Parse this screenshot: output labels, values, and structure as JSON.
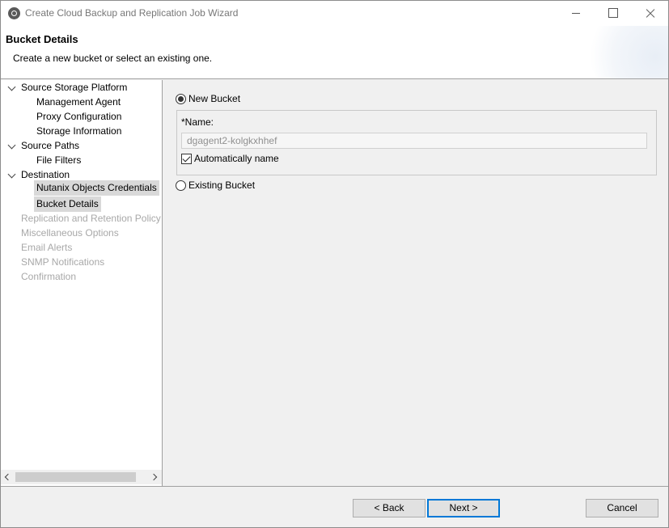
{
  "window": {
    "title": "Create Cloud Backup and Replication Job Wizard"
  },
  "header": {
    "title": "Bucket Details",
    "subtitle": "Create a new bucket or select an existing one."
  },
  "nav": {
    "items": [
      {
        "label": "Source Storage Platform",
        "state": "expanded"
      },
      {
        "label": "Management Agent",
        "state": "child"
      },
      {
        "label": "Proxy Configuration",
        "state": "child"
      },
      {
        "label": "Storage Information",
        "state": "child"
      },
      {
        "label": "Source Paths",
        "state": "expanded"
      },
      {
        "label": "File Filters",
        "state": "child"
      },
      {
        "label": "Destination",
        "state": "expanded"
      },
      {
        "label": "Nutanix Objects Credentials",
        "state": "selected"
      },
      {
        "label": "Bucket Details",
        "state": "selected-current"
      },
      {
        "label": "Replication and Retention Policy",
        "state": "disabled"
      },
      {
        "label": "Miscellaneous Options",
        "state": "disabled"
      },
      {
        "label": "Email Alerts",
        "state": "disabled"
      },
      {
        "label": "SNMP Notifications",
        "state": "disabled"
      },
      {
        "label": "Confirmation",
        "state": "disabled"
      }
    ]
  },
  "form": {
    "new_bucket_label": "New Bucket",
    "new_bucket_selected": true,
    "name_label": "*Name:",
    "name_value": "dgagent2-kolgkxhhef",
    "auto_name_label": "Automatically name",
    "auto_name_checked": true,
    "existing_bucket_label": "Existing Bucket",
    "existing_bucket_selected": false
  },
  "footer": {
    "back_label": "< Back",
    "next_label": "Next >",
    "cancel_label": "Cancel"
  },
  "colors": {
    "accent": "#0078d7",
    "disabled_text": "#a8a8a8",
    "selection_bg": "#d9d9d9"
  }
}
